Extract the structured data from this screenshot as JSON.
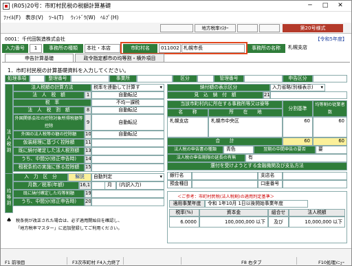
{
  "window": {
    "title": "(R05)20号：市町村民税の税額計算基礎",
    "minimize": "─",
    "maximize": "□",
    "close": "✕"
  },
  "menu": [
    "ﾌｧｲﾙ(F)",
    "表示(V)",
    "ﾂｰﾙ(T)",
    "ｳｨﾝﾄﾞｳ(W)",
    "ﾍﾙﾌﾟ(H)"
  ],
  "toolbar": {
    "btn1": "",
    "btn2": "地方税率ﾏｽﾀｰ",
    "btn3": "",
    "btn4": "",
    "form_tag": "第20号様式"
  },
  "header": {
    "company": "0001：千代田製造株式会社",
    "era": "【令和5年度】"
  },
  "infobar": {
    "input_no_label": "入力番号",
    "input_no": "1",
    "office_type_label": "事務所の種類",
    "office_type": "本社・本店",
    "city_label": "市町村名",
    "city_code": "011002",
    "city_name": "札幌市長",
    "office_name_label": "事務所の名称",
    "office_name": "札幌支店"
  },
  "tabs": [
    "申告計算基礎",
    "政令指定都市の均等割・横外項目"
  ],
  "main": {
    "instruction": "1．市町村民税の計算基礎資料を入力してください。",
    "row1": {
      "l1": "処理事項",
      "l2": "整理番号",
      "l3": "事業所",
      "l4": "区分",
      "l5": "管理番号",
      "l6": "申告区分"
    },
    "left": {
      "side_label": "法人税割",
      "r1_label": "法人税額の計算方法",
      "r1_value": "税率を連動して計算す",
      "r2_label": "法　人　税　額",
      "r2_num": "1",
      "r2_value": "自動転記",
      "r3_label": "税　率",
      "r3_value": "不均一課税",
      "r4_label": "法　人　税　割　額",
      "r4_num": "8",
      "r4_value": "自動転記",
      "r5_label": "外国関係会社の控除対象所得税額等控除",
      "r5_num": "9",
      "r5_value": "自動転記",
      "r6_label": "外国の法人税等の額の控除額",
      "r6_num": "10",
      "r6_value": "自動転記",
      "r7_label": "仮装経理に基づく控除額",
      "r7_num": "11",
      "r8_label": "既に納付確定した法人税割額",
      "r8_num": "13",
      "r9_label": "うち、中間分(修正申告時)",
      "r9_num": "14",
      "r10_label": "租税条約の実施に係る控除額",
      "r10_num": "15"
    },
    "kinto": {
      "side_label": "均等割",
      "r1_label": "入　力　区　分",
      "r1_btn": "解説",
      "r1_value": "自動判定",
      "r2_label": "月数／税率(年額)",
      "r2_num": "16,17",
      "r2_unit": "月",
      "r2_note": "(内訳入力)",
      "r3_label": "既に納付確定した均等割額",
      "r3_num": "19",
      "r4_label": "うち、中間分(修正申告時)",
      "r4_num": "20"
    },
    "right": {
      "r1_label": "納付額の表示区分",
      "r1_value": "入力省略(別様表示)",
      "r2_label": "見　込　納　付　額",
      "r2_num": "21",
      "t_header": "当該市町村内に所在する事務所等又は寮等",
      "t_col1": "名　　称",
      "t_col2": "所　　在　　地",
      "t_col3": "分割基準",
      "t_col4": "均等割の従業者数",
      "t_row_name": "札幌支店",
      "t_row_addr": "札幌市中央区",
      "t_row_div": "60",
      "t_row_emp": "60",
      "total_label": "合　　計",
      "total_div": "60",
      "total_emp": "60",
      "rank_label": "法人税の申告書の種類",
      "rank_value": "青色",
      "mid_label": "翌期の中間申告の要否",
      "mid_value": "要",
      "ext_label": "法人税の申告期限の延長の有無",
      "ext_value": "有",
      "refund_label": "還付を受けようとする金融機関及び支払方法",
      "bank_label": "銀行名",
      "branch_label": "支店名",
      "account_label": "預金種目",
      "post_label": "口座番号"
    },
    "ref": {
      "title": "＜ご参考：市町村民税(法人税割)の適用判定基準＞",
      "period_label": "適用事業年度",
      "period_value": "令和 1年10月 1日以後開始事業年度",
      "th_rate": "税率(%)",
      "th_capital": "資本金",
      "th_cond": "組合せ",
      "th_tax": "法人税額",
      "rate": "6.0000",
      "capital": "100,000,000 以下",
      "cond": "及び",
      "tax": "10,000,000 以下"
    },
    "warning_line1": "税条例が改正された場合は、必ず適用開始日を確認し、",
    "warning_line2": "「地方税率マスター」に追加登録してご利用ください。"
  },
  "footer": {
    "f1": "F1 前項目",
    "f3": "F3次市町村",
    "f4": "F4入力終了",
    "f8": "F8 右タブ",
    "f10": "F10処理ﾒﾆｭｰ"
  },
  "colors": {
    "accent_green": "#2f7d3a",
    "highlight_red": "#e2461d",
    "form_tag": "#b43a2a",
    "total_yellow": "#fbf09a"
  }
}
